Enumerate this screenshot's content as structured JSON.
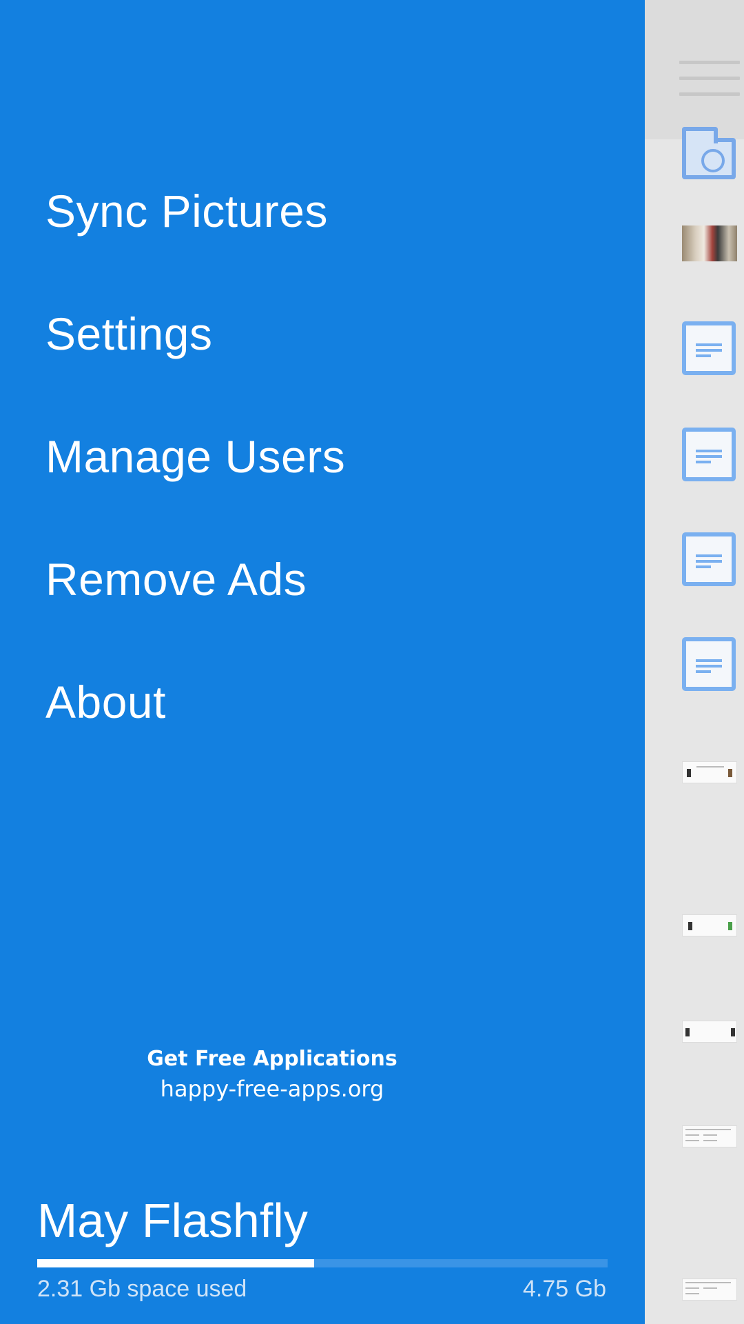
{
  "menu": {
    "items": [
      {
        "label": "Sync Pictures"
      },
      {
        "label": "Settings"
      },
      {
        "label": "Manage Users"
      },
      {
        "label": "Remove Ads"
      },
      {
        "label": "About"
      }
    ]
  },
  "promo": {
    "title": "Get Free Applications",
    "link": "happy-free-apps.org"
  },
  "account": {
    "user_name": "May Flashfly",
    "storage_used_text": "2.31 Gb space used",
    "storage_total_text": "4.75 Gb",
    "storage_used_fraction": 0.486
  },
  "colors": {
    "drawer_bg": "#1380e0",
    "accent": "#7ab0f0"
  },
  "file_list_icons": [
    "folder-web-icon",
    "photo-thumbnail",
    "document-icon",
    "document-icon",
    "document-icon",
    "document-icon",
    "screenshot-thumbnail",
    "screenshot-thumbnail",
    "screenshot-thumbnail",
    "screenshot-thumbnail",
    "screenshot-thumbnail"
  ]
}
